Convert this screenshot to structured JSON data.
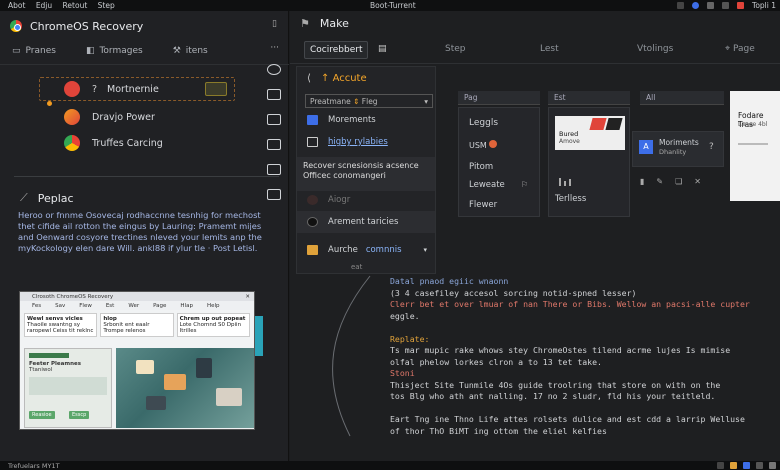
{
  "os_bar": {
    "menu": [
      "Abot",
      "Edju",
      "Retout",
      "Step"
    ],
    "center": "Boot-Turrent",
    "right_label": "Topli 1"
  },
  "left": {
    "title": "ChromeOS Recovery",
    "tabs": [
      "Pranes",
      "Tormages",
      "itens"
    ],
    "more": "···",
    "tasks": [
      {
        "num": "?",
        "label": "Mortnernie",
        "color": "#e0443a"
      },
      {
        "label": "Dravjo Power",
        "color": "#f29b21"
      },
      {
        "label": "Truffes Carcing",
        "color": "#4a8fd8"
      }
    ],
    "popup_heading": "Peplac",
    "popup_body": "Heroo or fnnme Osovecaj rodhaccnne tesnhig for mechost thet cifide ail rotton the eingus by Lauring: Pramemt mijes and Oenward cosyore trectines nleved your lemits anp the myKockology elen dare Will. ankl88 if ylur tle · Post Letisl.",
    "thumb": {
      "title": "Clrosoth ChromeOS Recovery",
      "menu": [
        "Fes",
        "Sav",
        "Flew",
        "Est",
        "Wer",
        "Page",
        "Hlap",
        "Help"
      ],
      "cols": [
        {
          "title": "Wewl senvs vicles",
          "text": "Thaoile swantng sy raropewl Ceiss tit reklnc"
        },
        {
          "title": "hlop",
          "text": "Srbonit ent eaalr Trompe relenos"
        },
        {
          "title": "Chrem up out popeat",
          "text": "Lote Chomnd S0 Dpiin Itrilles"
        }
      ],
      "lower_title": "Feeter Pleamnes",
      "lower_sub": "Ttaniwol",
      "buttons": [
        "Reasioe",
        "Esscp"
      ]
    }
  },
  "right": {
    "title": "Make",
    "tabs": [
      "Cocirebbert",
      "Step",
      "Lest",
      "Vtolings",
      "Page"
    ],
    "dropdown": {
      "heading": "Accute",
      "filter_left": "Preatmane",
      "filter_right": "Fleg",
      "rows": [
        "Morements",
        "higby rylabies"
      ],
      "section": "Recover scnesionsis acsence Officec conomangeri",
      "items": [
        "Aiogr",
        "Arement taricies",
        "Aurche"
      ],
      "item_link": "comnnis",
      "footer": "eat"
    },
    "columns": {
      "headers": [
        "Pag",
        "Est",
        "All"
      ],
      "c1": [
        "Leggls",
        "USM",
        "Pitom",
        "Leweate",
        "Flewer"
      ],
      "c2": {
        "card_title": "Bured",
        "card_sub": "Amove",
        "footer": "Terlless"
      },
      "c3": {
        "badge": "A",
        "title": "Moriments",
        "sub": "Dhanlity"
      },
      "c4": {
        "title": "Fodare Tras",
        "sub": "Lanee 4bl"
      }
    },
    "code": [
      {
        "cls": "c1",
        "text": "Datal pnaod egiic wnaonn"
      },
      {
        "cls": "",
        "text": "(3 4 casefiley accesol sorcing notid-spned lesser)"
      },
      {
        "cls": "c2",
        "text": "Clerr bet et over lmuar of nan There or Bibs. Wellow an pacsi-alle cupter"
      },
      {
        "cls": "",
        "text": "eggle."
      },
      {
        "cls": "",
        "text": ""
      },
      {
        "cls": "c3",
        "text": "Replate:"
      },
      {
        "cls": "",
        "text": " Ts mar mupic rake whows stey ChromeOstes tilend acrme lujes Is mimise"
      },
      {
        "cls": "",
        "text": "  olfal phelow lorkes clron a to 13 tet take."
      },
      {
        "cls": "c2",
        "text": "Stoni"
      },
      {
        "cls": "",
        "text": " Thisject Site Tunmile 4Os guide troolring that store on with on the"
      },
      {
        "cls": "",
        "text": " tos Blg who ath ant nalling. 17 no 2 sludr, fld his your teitleld."
      },
      {
        "cls": "",
        "text": ""
      },
      {
        "cls": "",
        "text": " Eart Tng ine Thno Life attes rolsets dulice and est cdd a larrip Welluse"
      },
      {
        "cls": "",
        "text": "  of thor ThO BiMT ing ottom the eliel kelfies"
      }
    ]
  },
  "status_bar": {
    "left": "Trefuelars MY1T"
  }
}
